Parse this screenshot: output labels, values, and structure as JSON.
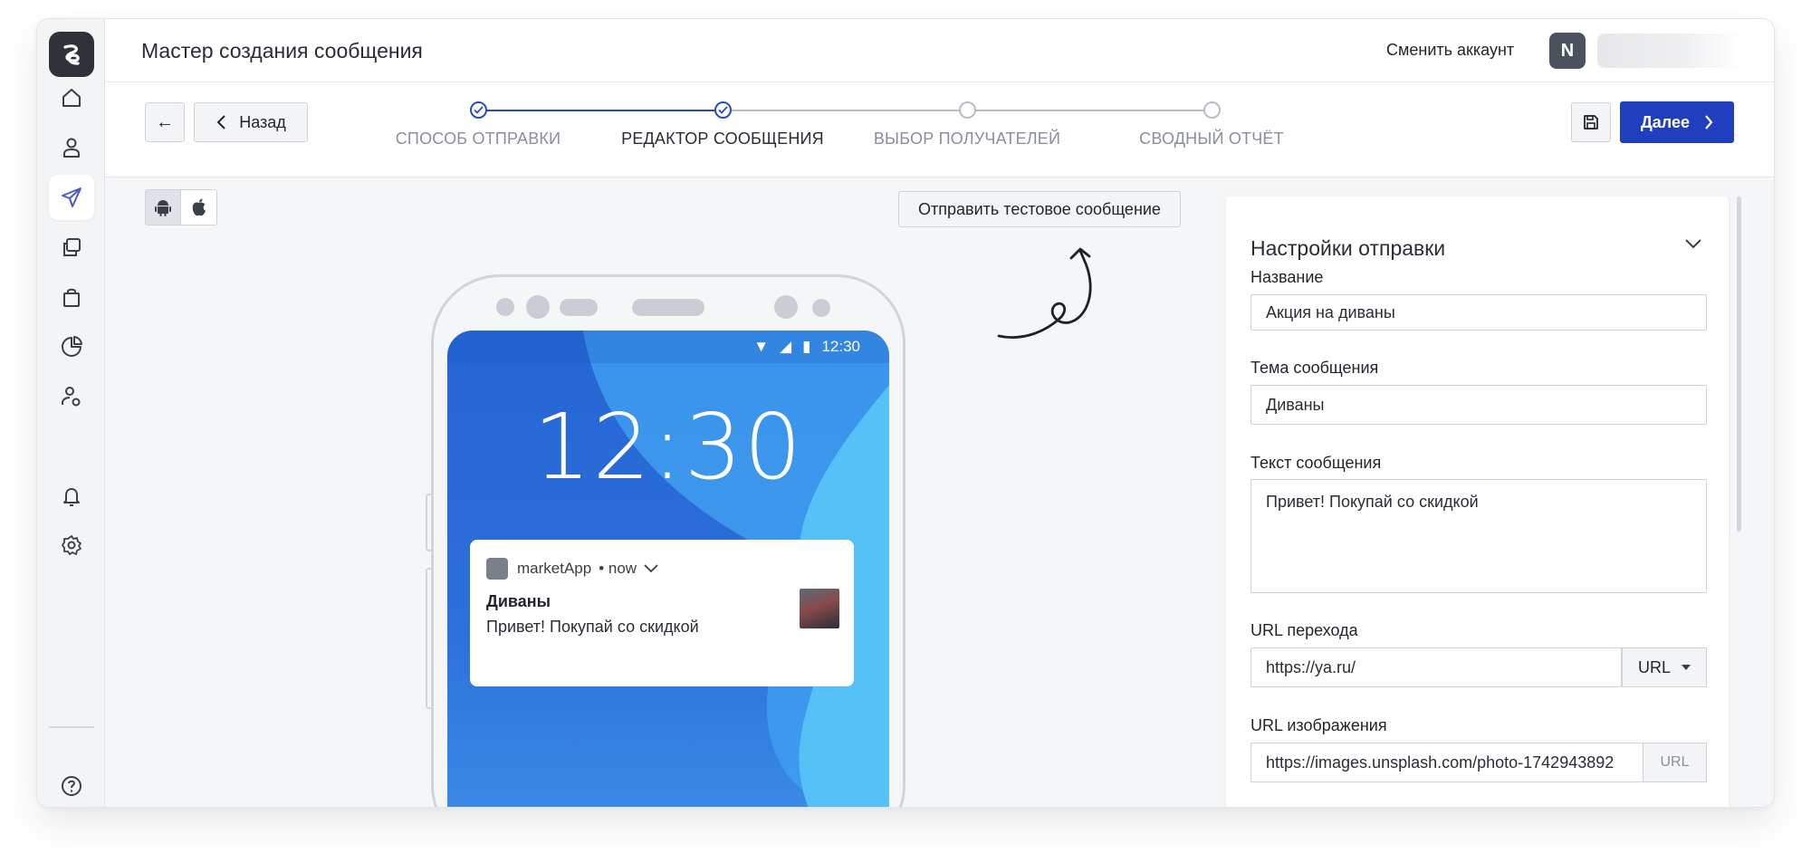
{
  "header": {
    "title": "Мастер создания сообщения",
    "switch_account": "Сменить аккаунт",
    "avatar_initial": "N"
  },
  "sidebar": {
    "items": [
      {
        "name": "home-icon",
        "active": false
      },
      {
        "name": "user-icon",
        "active": false
      },
      {
        "name": "send-icon",
        "active": true
      },
      {
        "name": "copy-icon",
        "active": false
      },
      {
        "name": "bag-icon",
        "active": false
      },
      {
        "name": "pie-chart-icon",
        "active": false
      },
      {
        "name": "user-settings-icon",
        "active": false
      },
      {
        "name": "bell-icon",
        "active": false
      },
      {
        "name": "gear-icon",
        "active": false
      },
      {
        "name": "help-icon",
        "active": false
      }
    ]
  },
  "toolbar": {
    "back_label": "Назад",
    "next_label": "Далее"
  },
  "steps": [
    {
      "label": "СПОСОБ ОТПРАВКИ",
      "status": "done"
    },
    {
      "label": "РЕДАКТОР СООБЩЕНИЯ",
      "status": "current"
    },
    {
      "label": "ВЫБОР ПОЛУЧАТЕЛЕЙ",
      "status": "pending"
    },
    {
      "label": "СВОДНЫЙ ОТЧЁТ",
      "status": "pending"
    }
  ],
  "preview": {
    "send_test_label": "Отправить тестовое сообщение",
    "status_time": "12:30",
    "lock_clock": "12:30",
    "notification": {
      "app": "marketApp",
      "when": "• now",
      "title": "Диваны",
      "body": "Привет! Покупай со скидкой"
    }
  },
  "settings": {
    "title": "Настройки отправки",
    "name_label": "Название",
    "name_value": "Акция на диваны",
    "subject_label": "Тема сообщения",
    "subject_value": "Диваны",
    "text_label": "Текст сообщения",
    "text_value": "Привет! Покупай со скидкой",
    "url_label": "URL перехода",
    "url_value": "https://ya.ru/",
    "url_type": "URL",
    "image_url_label": "URL изображения",
    "image_url_value": "https://images.unsplash.com/photo-1742943892",
    "image_url_type": "URL"
  },
  "colors": {
    "accent": "#1f3fbf",
    "step_done": "#2a49c9",
    "screen_blue": "#2566d4",
    "sidebar_active": "#4a5cc8"
  }
}
